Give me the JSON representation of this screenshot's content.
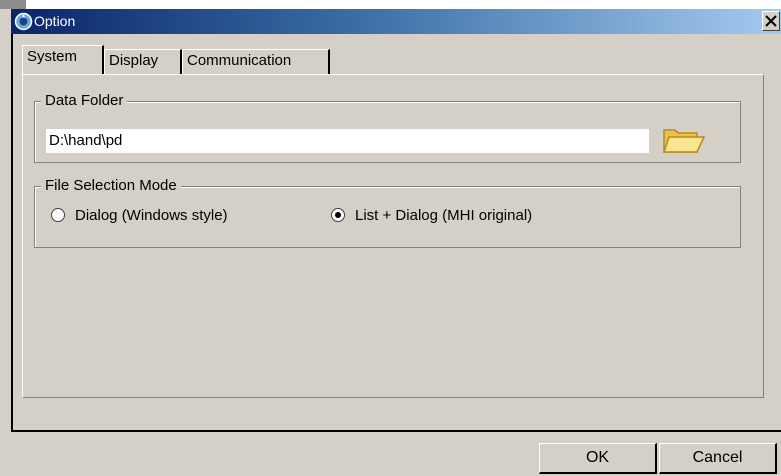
{
  "window": {
    "title": "Option",
    "close_label": "X"
  },
  "tabs": [
    {
      "label": "System",
      "active": true
    },
    {
      "label": "Display",
      "active": false
    },
    {
      "label": "Communication",
      "active": false
    }
  ],
  "data_folder": {
    "label": "Data Folder",
    "value": "D:\\hand\\pd",
    "browse_icon": "folder-icon"
  },
  "file_selection": {
    "label": "File Selection Mode",
    "options": [
      {
        "label": "Dialog (Windows style)",
        "checked": false
      },
      {
        "label": "List + Dialog (MHI original)",
        "checked": true
      }
    ]
  },
  "buttons": {
    "ok": "OK",
    "cancel": "Cancel"
  },
  "colors": {
    "titlebar_start": "#0a246a",
    "titlebar_end": "#a6caf0",
    "face": "#d4d0c8",
    "folder": "#f6d86b"
  }
}
